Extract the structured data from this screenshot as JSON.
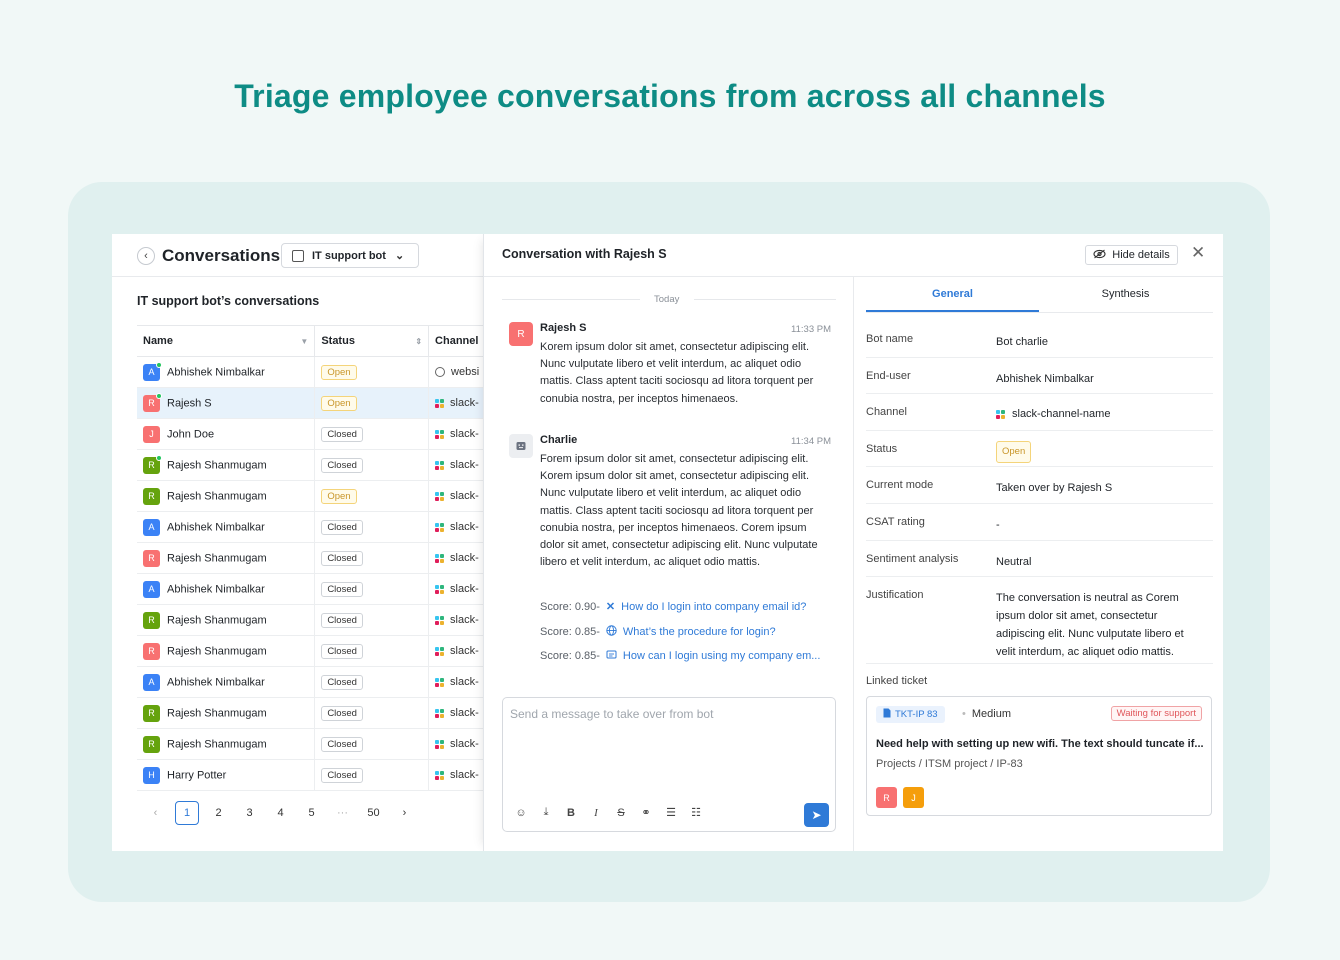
{
  "hero_title": "Triage employee conversations from across all channels",
  "left": {
    "title": "Conversations",
    "bot_select": "IT support bot",
    "subtitle": "IT support bot’s conversations",
    "columns": [
      "Name",
      "Status",
      "Channel"
    ],
    "rows": [
      {
        "initial": "A",
        "name": "Abhishek Nimbalkar",
        "status": "Open",
        "channel": "websi",
        "channel_icon": "globe-icon",
        "color": "#3b82f6",
        "online": true
      },
      {
        "initial": "R",
        "name": "Rajesh S",
        "status": "Open",
        "channel": "slack-",
        "channel_icon": "slack-icon",
        "color": "#f87171",
        "online": true
      },
      {
        "initial": "J",
        "name": "John Doe",
        "status": "Closed",
        "channel": "slack-",
        "channel_icon": "slack-icon",
        "color": "#f87171",
        "online": false
      },
      {
        "initial": "R",
        "name": "Rajesh Shanmugam",
        "status": "Closed",
        "channel": "slack-",
        "channel_icon": "slack-icon",
        "color": "#65a30d",
        "online": true
      },
      {
        "initial": "R",
        "name": "Rajesh Shanmugam",
        "status": "Open",
        "channel": "slack-",
        "channel_icon": "slack-icon",
        "color": "#65a30d",
        "online": false
      },
      {
        "initial": "A",
        "name": "Abhishek Nimbalkar",
        "status": "Closed",
        "channel": "slack-",
        "channel_icon": "slack-icon",
        "color": "#3b82f6",
        "online": false
      },
      {
        "initial": "R",
        "name": "Rajesh Shanmugam",
        "status": "Closed",
        "channel": "slack-",
        "channel_icon": "slack-icon",
        "color": "#f87171",
        "online": false
      },
      {
        "initial": "A",
        "name": "Abhishek Nimbalkar",
        "status": "Closed",
        "channel": "slack-",
        "channel_icon": "slack-icon",
        "color": "#3b82f6",
        "online": false
      },
      {
        "initial": "R",
        "name": "Rajesh Shanmugam",
        "status": "Closed",
        "channel": "slack-",
        "channel_icon": "slack-icon",
        "color": "#65a30d",
        "online": false
      },
      {
        "initial": "R",
        "name": "Rajesh Shanmugam",
        "status": "Closed",
        "channel": "slack-",
        "channel_icon": "slack-icon",
        "color": "#f87171",
        "online": false
      },
      {
        "initial": "A",
        "name": "Abhishek Nimbalkar",
        "status": "Closed",
        "channel": "slack-",
        "channel_icon": "slack-icon",
        "color": "#3b82f6",
        "online": false
      },
      {
        "initial": "R",
        "name": "Rajesh Shanmugam",
        "status": "Closed",
        "channel": "slack-",
        "channel_icon": "slack-icon",
        "color": "#65a30d",
        "online": false
      },
      {
        "initial": "R",
        "name": "Rajesh Shanmugam",
        "status": "Closed",
        "channel": "slack-",
        "channel_icon": "slack-icon",
        "color": "#65a30d",
        "online": false
      },
      {
        "initial": "H",
        "name": "Harry Potter",
        "status": "Closed",
        "channel": "slack-",
        "channel_icon": "slack-icon",
        "color": "#3b82f6",
        "online": false
      }
    ],
    "pagination": {
      "prev": "‹",
      "pages": [
        "1",
        "2",
        "3",
        "4",
        "5",
        "···",
        "50"
      ],
      "current": "1",
      "next": "›"
    }
  },
  "conversation": {
    "title": "Conversation with Rajesh S",
    "hide_details": "Hide details",
    "day_label": "Today",
    "messages": [
      {
        "initial": "R",
        "author": "Rajesh S",
        "time": "11:33 PM",
        "text": "Korem ipsum dolor sit amet, consectetur adipiscing elit. Nunc vulputate libero et velit interdum, ac aliquet odio mattis. Class aptent taciti sociosqu ad litora torquent per conubia nostra, per inceptos himenaeos."
      },
      {
        "initial": "bot-icon",
        "author": "Charlie",
        "time": "11:34 PM",
        "text": "Forem ipsum dolor sit amet, consectetur adipiscing elit. Korem ipsum dolor sit amet, consectetur adipiscing elit. Nunc vulputate libero et velit interdum, ac aliquet odio mattis. Class aptent taciti sociosqu ad litora torquent per conubia nostra, per inceptos himenaeos. Corem ipsum dolor sit amet, consectetur adipiscing elit. Nunc vulputate libero et velit interdum, ac aliquet odio mattis."
      }
    ],
    "sources": [
      {
        "score": "Score: 0.90-",
        "icon": "confluence-icon",
        "link": "How do I login into company email id?"
      },
      {
        "score": "Score: 0.85-",
        "icon": "globe-icon",
        "link": "What’s the procedure for login?"
      },
      {
        "score": "Score: 0.85-",
        "icon": "document-icon",
        "link": "How can I login using my company em..."
      }
    ],
    "composer_placeholder": "Send a message to take over from bot"
  },
  "details": {
    "tabs": [
      "General",
      "Synthesis"
    ],
    "active_tab": "General",
    "fields": [
      {
        "key": "Bot name",
        "value": "Bot charlie"
      },
      {
        "key": "End-user",
        "value": "Abhishek Nimbalkar"
      },
      {
        "key": "Channel",
        "value": "slack-channel-name"
      },
      {
        "key": "Status",
        "value": "Open"
      },
      {
        "key": "Current mode",
        "value": "Taken over by Rajesh S"
      },
      {
        "key": "CSAT rating",
        "value": "-"
      },
      {
        "key": "Sentiment analysis",
        "value": "Neutral"
      },
      {
        "key": "Justification",
        "value": "The conversation is neutral as Corem ipsum dolor sit amet, consectetur adipiscing elit. Nunc vulputate libero et velit interdum, ac aliquet odio mattis."
      }
    ],
    "linked_ticket_label": "Linked ticket",
    "ticket": {
      "id": "TKT-IP 83",
      "priority": "Medium",
      "status": "Waiting for support",
      "title": "Need help with setting up new wifi. The text should tuncate if...",
      "path": "Projects / ITSM project / IP-83",
      "assignees": [
        {
          "initial": "R",
          "color": "#f87171"
        },
        {
          "initial": "J",
          "color": "#f59e0b"
        }
      ]
    }
  },
  "colors": {
    "accent": "#2f7ad7",
    "hero": "#0e8c85",
    "open_badge": "#c9962a",
    "waiting_badge": "#e0575b"
  }
}
